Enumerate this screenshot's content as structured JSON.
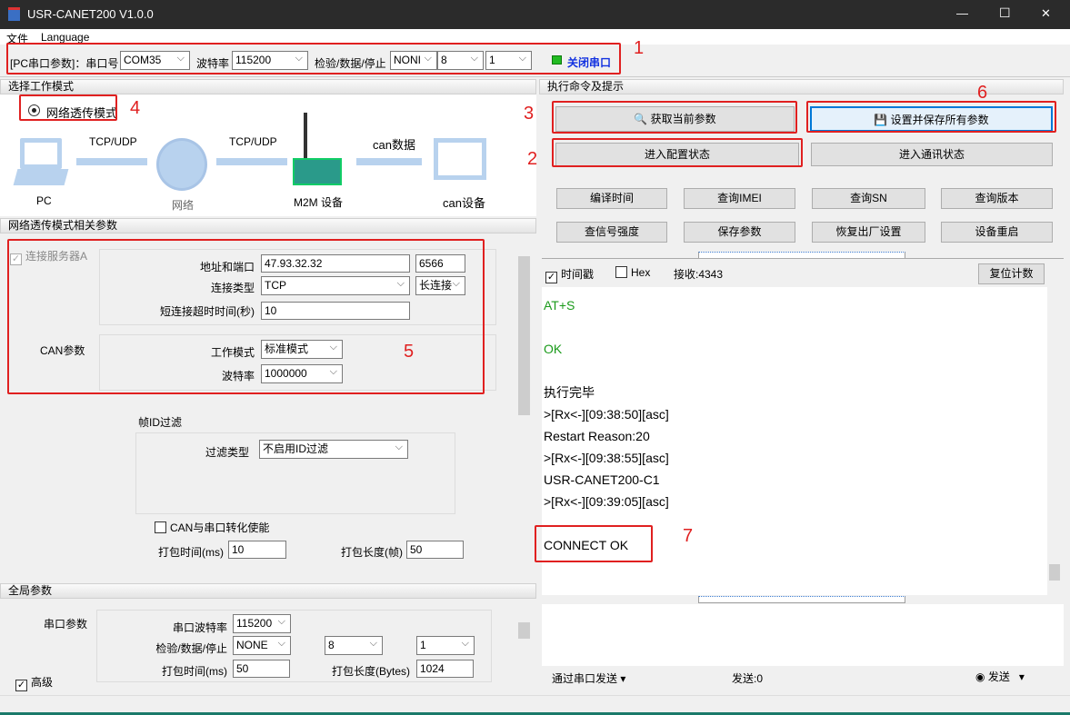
{
  "window": {
    "title": "USR-CANET200 V1.0.0",
    "minimize": "—",
    "maximize": "☐",
    "close": "✕"
  },
  "menu": [
    "文件",
    "Language"
  ],
  "toolbar": {
    "pc_params": "[PC串口参数]：串口号",
    "port": "COM35",
    "baud_label": "波特率",
    "baud": "115200",
    "parity_label": "检验/数据/停止",
    "parity": "NONI",
    "data_bits": "8",
    "stop_bits": "1",
    "close_port": "关闭串口",
    "led_color": "#22bb22"
  },
  "left": {
    "mode_header": "选择工作模式",
    "mode_radio": "网络透传模式",
    "diagram": {
      "arrow1": "TCP/UDP",
      "arrow2": "TCP/UDP",
      "arrow3": "can数据",
      "pc": "PC",
      "net": "网络",
      "m2m": "M2M 设备",
      "can_dev": "can设备"
    },
    "params_header": "网络透传模式相关参数",
    "connect_server": "连接服务器A",
    "addr_label": "地址和端口",
    "addr": "47.93.32.32",
    "port": "6566",
    "conn_type_label": "连接类型",
    "conn_type": "TCP",
    "conn_mode": "长连接",
    "timeout_label": "短连接超时时间(秒)",
    "timeout": "10",
    "can_params": "CAN参数",
    "work_mode_label": "工作模式",
    "work_mode": "标准模式",
    "can_baud_label": "波特率",
    "can_baud": "1000000",
    "frame_filter": "帧ID过滤",
    "filter_type_label": "过滤类型",
    "filter_type": "不启用ID过滤",
    "can_serial": "CAN与串口转化使能",
    "pack_time_label": "打包时间(ms)",
    "pack_time": "10",
    "pack_len_label": "打包长度(帧)",
    "pack_len": "50",
    "global_header": "全局参数",
    "serial_params": "串口参数",
    "serial_baud_label": "串口波特率",
    "serial_baud": "115200",
    "serial_parity_label": "检验/数据/停止",
    "serial_parity": "NONE",
    "serial_data": "8",
    "serial_stop": "1",
    "g_pack_time_label": "打包时间(ms)",
    "g_pack_time": "50",
    "g_pack_len_label": "打包长度(Bytes)",
    "g_pack_len": "1024",
    "advanced": "高级"
  },
  "right": {
    "header": "执行命令及提示",
    "get_params": "获取当前参数",
    "save_all": "设置并保存所有参数",
    "enter_config": "进入配置状态",
    "enter_comm": "进入通讯状态",
    "small_buttons": [
      "编译时间",
      "查询IMEI",
      "查询SN",
      "查询版本",
      "查信号强度",
      "保存参数",
      "恢复出厂设置",
      "设备重启"
    ],
    "timestamp": "时间戳",
    "hex": "Hex",
    "recv": "接收:4343",
    "reset_count": "复位计数",
    "log": [
      {
        "t": "AT+S",
        "c": "#1a9a1a"
      },
      {
        "t": "",
        "c": "#000"
      },
      {
        "t": "OK",
        "c": "#1a9a1a"
      },
      {
        "t": "",
        "c": "#000"
      },
      {
        "t": "执行完毕",
        "c": "#000"
      },
      {
        "t": ">[Rx<-][09:38:50][asc]",
        "c": "#000"
      },
      {
        "t": "Restart Reason:20",
        "c": "#000"
      },
      {
        "t": ">[Rx<-][09:38:55][asc]",
        "c": "#000"
      },
      {
        "t": "USR-CANET200-C1",
        "c": "#000"
      },
      {
        "t": ">[Rx<-][09:39:05][asc]",
        "c": "#000"
      },
      {
        "t": "",
        "c": "#000"
      },
      {
        "t": "CONNECT OK",
        "c": "#000"
      }
    ],
    "send_via": "通过串口发送",
    "sent": "发送:0",
    "send": "发送"
  },
  "annotations": [
    "1",
    "2",
    "3",
    "4",
    "5",
    "6",
    "7"
  ]
}
